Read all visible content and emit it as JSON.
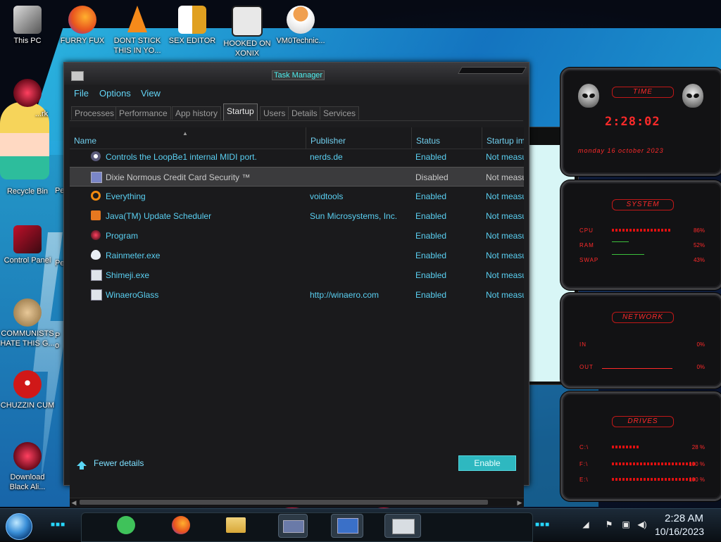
{
  "desktop_icons": [
    {
      "label": "This PC"
    },
    {
      "label": "FURRY FUX"
    },
    {
      "label": "DONT STICK THIS IN YO..."
    },
    {
      "label": "SEX EDITOR"
    },
    {
      "label": "HOOKED ON XONIX"
    },
    {
      "label": "VM0Technic..."
    },
    {
      "label": "...rk"
    },
    {
      "label": "Recycle Bin"
    },
    {
      "label": "Pe"
    },
    {
      "label": "Control Panel"
    },
    {
      "label": "Pe"
    },
    {
      "label": "COMMUNISTS HATE THIS G..."
    },
    {
      "label": "P o"
    },
    {
      "label": "CHUZZIN CUM"
    },
    {
      "label": "Download Black Ali..."
    }
  ],
  "task_manager": {
    "title": "Task Manager",
    "menu": [
      "File",
      "Options",
      "View"
    ],
    "tabs": [
      "Processes",
      "Performance",
      "App history",
      "Startup",
      "Users",
      "Details",
      "Services"
    ],
    "active_tab": "Startup",
    "columns": [
      "Name",
      "Publisher",
      "Status",
      "Startup im"
    ],
    "rows": [
      {
        "name": "Controls the LoopBe1 internal MIDI port.",
        "publisher": "nerds.de",
        "status": "Enabled",
        "impact": "Not measu",
        "icon": "midi-icon",
        "selected": false
      },
      {
        "name": "Dixie Normous Credit Card Security ™",
        "publisher": "",
        "status": "Disabled",
        "impact": "Not measu",
        "icon": "card-icon",
        "selected": true
      },
      {
        "name": "Everything",
        "publisher": "voidtools",
        "status": "Enabled",
        "impact": "Not measu",
        "icon": "magnifier-icon",
        "selected": false
      },
      {
        "name": "Java(TM) Update Scheduler",
        "publisher": "Sun Microsystems, Inc.",
        "status": "Enabled",
        "impact": "Not measu",
        "icon": "java-icon",
        "selected": false
      },
      {
        "name": "Program",
        "publisher": "",
        "status": "Enabled",
        "impact": "Not measu",
        "icon": "program-icon",
        "selected": false
      },
      {
        "name": "Rainmeter.exe",
        "publisher": "",
        "status": "Enabled",
        "impact": "Not measu",
        "icon": "droplet-icon",
        "selected": false
      },
      {
        "name": "Shimeji.exe",
        "publisher": "",
        "status": "Enabled",
        "impact": "Not measu",
        "icon": "window-icon",
        "selected": false
      },
      {
        "name": "WinaeroGlass",
        "publisher": "http://winaero.com",
        "status": "Enabled",
        "impact": "Not measu",
        "icon": "window-icon",
        "selected": false
      }
    ],
    "fewer_details": "Fewer details",
    "enable_button": "Enable"
  },
  "rainmeter": {
    "time_header": "TIME",
    "time": "2:28:02",
    "date": "monday 16 october 2023",
    "system_header": "SYSTEM",
    "cpu_label": "CPU",
    "cpu_value": "86%",
    "ram_label": "RAM",
    "ram_value": "52%",
    "swap_label": "SWAP",
    "swap_value": "43%",
    "network_header": "NETWORK",
    "in_label": "IN",
    "in_value": "0%",
    "out_label": "OUT",
    "out_value": "0%",
    "drives_header": "DRIVES",
    "drives": [
      {
        "label": "C:\\",
        "value": "28 %"
      },
      {
        "label": "F:\\",
        "value": "100 %"
      },
      {
        "label": "E:\\",
        "value": "100 %"
      }
    ]
  },
  "taskbar": {
    "clock_time": "2:28 AM",
    "clock_date": "10/16/2023"
  },
  "colors": {
    "accent": "#5ad0f2",
    "widget_red": "#ff2a2a",
    "enable_button": "#2eb8c0"
  }
}
